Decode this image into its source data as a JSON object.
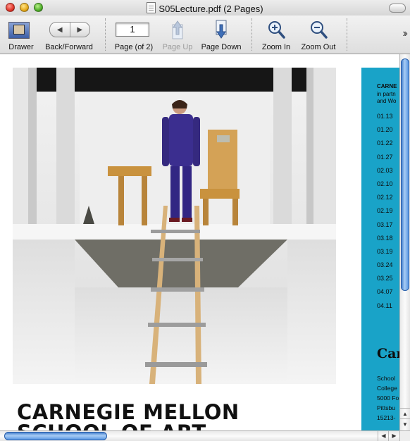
{
  "window": {
    "title": "S05Lecture.pdf (2 Pages)"
  },
  "toolbar": {
    "drawer_label": "Drawer",
    "backforward_label": "Back/Forward",
    "page_value": "1",
    "page_label": "Page (of 2)",
    "page_up_label": "Page Up",
    "page_down_label": "Page Down",
    "zoom_in_label": "Zoom In",
    "zoom_out_label": "Zoom Out"
  },
  "page1": {
    "heading_line1": "CARNEGIE MELLON",
    "heading_line2": "SCHOOL OF ART"
  },
  "page2": {
    "title": "CARNE",
    "subtitle_lines": [
      "in partn",
      "and Wo"
    ],
    "dates": [
      "01.13",
      "01.20",
      "01.22",
      "01.27",
      "02.03",
      "02.10",
      "02.12",
      "02.19",
      "03.17",
      "03.18",
      "03.19",
      "03.24",
      "03.25",
      "04.07",
      "04.11"
    ],
    "logo": "Car",
    "address_lines": [
      "School",
      "College",
      "5000 Fo",
      "Pittsbu",
      "15213-"
    ]
  },
  "colors": {
    "accent_panel": "#19a3c8",
    "scroll_thumb": "#4a8de0"
  }
}
